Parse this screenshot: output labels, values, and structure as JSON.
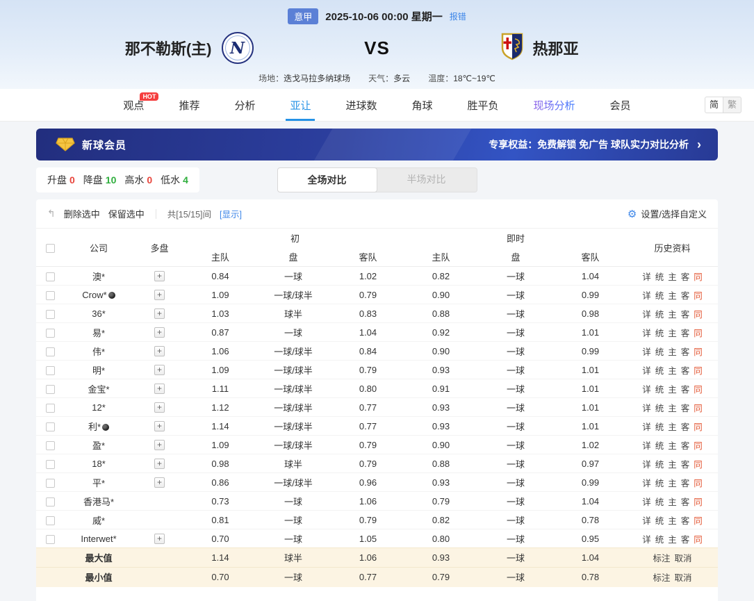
{
  "match_header": {
    "league_badge": "意甲",
    "datetime": "2025-10-06 00:00 星期一",
    "report_error": "报错",
    "home_team": "那不勒斯(主)",
    "home_logo_letter": "N",
    "vs": "VS",
    "away_team": "热那亚",
    "venue_label": "场地：",
    "venue": "迭戈马拉多纳球场",
    "weather_label": "天气：",
    "weather": "多云",
    "temp_label": "温度：",
    "temperature": "18℃~19℃"
  },
  "nav": {
    "tabs": [
      {
        "label": "观点",
        "name": "viewpoint",
        "badge": "HOT"
      },
      {
        "label": "推荐",
        "name": "recommend"
      },
      {
        "label": "分析",
        "name": "analysis"
      },
      {
        "label": "亚让",
        "name": "asian-handicap",
        "active": true
      },
      {
        "label": "进球数",
        "name": "goals"
      },
      {
        "label": "角球",
        "name": "corners"
      },
      {
        "label": "胜平负",
        "name": "win-draw-lose"
      },
      {
        "label": "现场分析",
        "name": "live-analysis",
        "highlight": true
      },
      {
        "label": "会员",
        "name": "member"
      }
    ],
    "lang_simplified": "简",
    "lang_traditional": "繁"
  },
  "promo_banner": {
    "title": "新球会员",
    "benefits": "专享权益：免费解锁 免广告 球队实力对比分析",
    "arrow": "›"
  },
  "filters": {
    "items": [
      {
        "label": "升盘",
        "name": "up-odds",
        "value": "0",
        "color": "red"
      },
      {
        "label": "降盘",
        "name": "down-odds",
        "value": "10",
        "color": "green"
      },
      {
        "label": "高水",
        "name": "high-water",
        "value": "0",
        "color": "red"
      },
      {
        "label": "低水",
        "name": "low-water",
        "value": "4",
        "color": "green"
      }
    ],
    "full_match_tab": "全场对比",
    "half_match_tab": "半场对比"
  },
  "table_controls": {
    "delete_selected": "删除选中",
    "keep_selected": "保留选中",
    "count_text": "共[15/15]间",
    "show_link": "[显示]",
    "settings": "设置/选择自定义"
  },
  "odds_table": {
    "header": {
      "company": "公司",
      "multi": "多盘",
      "initial_group": "初",
      "live_group": "即时",
      "home": "主队",
      "handicap": "盘",
      "away": "客队",
      "history": "历史资料"
    },
    "history_links": [
      {
        "label": "详",
        "name": "history-detail-link"
      },
      {
        "label": "统",
        "name": "history-stats-link"
      },
      {
        "label": "主",
        "name": "history-home-link"
      },
      {
        "label": "客",
        "name": "history-away-link"
      },
      {
        "label": "同",
        "name": "history-same-link",
        "accent": true
      }
    ],
    "summary_links": [
      {
        "label": "标注",
        "name": "annotate-link"
      },
      {
        "label": "取消",
        "name": "cancel-link"
      }
    ],
    "rows": [
      {
        "company": "澳*",
        "icon": false,
        "multi": true,
        "init_home": "0.84",
        "init_handicap": "一球",
        "init_away": "1.02",
        "live_home": "0.82",
        "live_handicap": "一球",
        "live_away": "1.04"
      },
      {
        "company": "Crow*",
        "icon": true,
        "multi": true,
        "init_home": "1.09",
        "init_handicap": "一球/球半",
        "init_away": "0.79",
        "live_home": "0.90",
        "live_handicap": "一球",
        "live_away": "0.99"
      },
      {
        "company": "36*",
        "icon": false,
        "multi": true,
        "init_home": "1.03",
        "init_handicap": "球半",
        "init_away": "0.83",
        "live_home": "0.88",
        "live_handicap": "一球",
        "live_away": "0.98"
      },
      {
        "company": "易*",
        "icon": false,
        "multi": true,
        "init_home": "0.87",
        "init_handicap": "一球",
        "init_away": "1.04",
        "live_home": "0.92",
        "live_handicap": "一球",
        "live_away": "1.01"
      },
      {
        "company": "伟*",
        "icon": false,
        "multi": true,
        "init_home": "1.06",
        "init_handicap": "一球/球半",
        "init_away": "0.84",
        "live_home": "0.90",
        "live_handicap": "一球",
        "live_away": "0.99"
      },
      {
        "company": "明*",
        "icon": false,
        "multi": true,
        "init_home": "1.09",
        "init_handicap": "一球/球半",
        "init_away": "0.79",
        "live_home": "0.93",
        "live_handicap": "一球",
        "live_away": "1.01"
      },
      {
        "company": "金宝*",
        "icon": false,
        "multi": true,
        "init_home": "1.11",
        "init_handicap": "一球/球半",
        "init_away": "0.80",
        "live_home": "0.91",
        "live_handicap": "一球",
        "live_away": "1.01"
      },
      {
        "company": "12*",
        "icon": false,
        "multi": true,
        "init_home": "1.12",
        "init_handicap": "一球/球半",
        "init_away": "0.77",
        "live_home": "0.93",
        "live_handicap": "一球",
        "live_away": "1.01"
      },
      {
        "company": "利*",
        "icon": true,
        "multi": true,
        "init_home": "1.14",
        "init_handicap": "一球/球半",
        "init_away": "0.77",
        "live_home": "0.93",
        "live_handicap": "一球",
        "live_away": "1.01"
      },
      {
        "company": "盈*",
        "icon": false,
        "multi": true,
        "init_home": "1.09",
        "init_handicap": "一球/球半",
        "init_away": "0.79",
        "live_home": "0.90",
        "live_handicap": "一球",
        "live_away": "1.02"
      },
      {
        "company": "18*",
        "icon": false,
        "multi": true,
        "init_home": "0.98",
        "init_handicap": "球半",
        "init_away": "0.79",
        "live_home": "0.88",
        "live_handicap": "一球",
        "live_away": "0.97"
      },
      {
        "company": "平*",
        "icon": false,
        "multi": true,
        "init_home": "0.86",
        "init_handicap": "一球/球半",
        "init_away": "0.96",
        "live_home": "0.93",
        "live_handicap": "一球",
        "live_away": "0.99"
      },
      {
        "company": "香港马*",
        "icon": false,
        "multi": false,
        "init_home": "0.73",
        "init_handicap": "一球",
        "init_away": "1.06",
        "live_home": "0.79",
        "live_handicap": "一球",
        "live_away": "1.04"
      },
      {
        "company": "威*",
        "icon": false,
        "multi": false,
        "init_home": "0.81",
        "init_handicap": "一球",
        "init_away": "0.79",
        "live_home": "0.82",
        "live_handicap": "一球",
        "live_away": "0.78"
      },
      {
        "company": "Interwet*",
        "icon": false,
        "multi": true,
        "init_home": "0.70",
        "init_handicap": "一球",
        "init_away": "1.05",
        "live_home": "0.80",
        "live_handicap": "一球",
        "live_away": "0.95"
      }
    ],
    "summary_rows": [
      {
        "label": "最大值",
        "init_home": "1.14",
        "init_handicap": "球半",
        "init_away": "1.06",
        "live_home": "0.93",
        "live_handicap": "一球",
        "live_away": "1.04"
      },
      {
        "label": "最小值",
        "init_home": "0.70",
        "init_handicap": "一球",
        "init_away": "0.77",
        "live_home": "0.79",
        "live_handicap": "一球",
        "live_away": "0.78"
      }
    ]
  }
}
